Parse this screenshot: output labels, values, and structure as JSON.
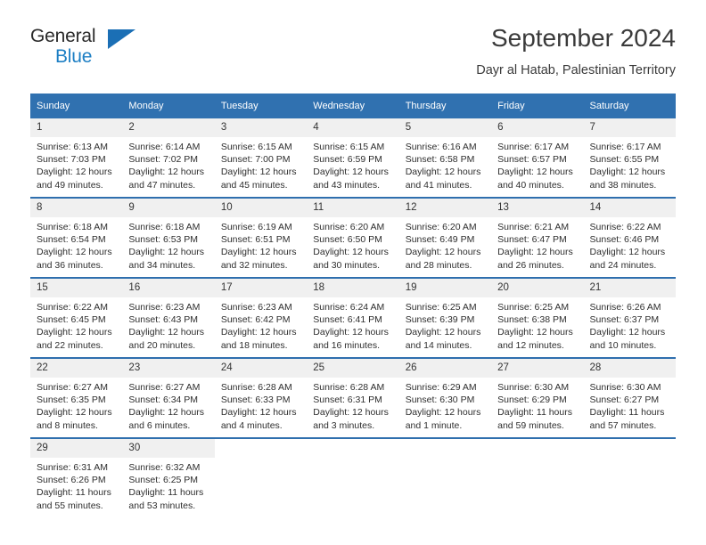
{
  "brand": {
    "name_part1": "General",
    "name_part2": "Blue"
  },
  "header": {
    "title": "September 2024",
    "subtitle": "Dayr al Hatab, Palestinian Territory"
  },
  "columns": [
    "Sunday",
    "Monday",
    "Tuesday",
    "Wednesday",
    "Thursday",
    "Friday",
    "Saturday"
  ],
  "colors": {
    "header_blue": "#3071b0",
    "row_divider_blue": "#2f6fae",
    "daynum_band": "#f0f0f0",
    "brand_blue": "#1d7fc4"
  },
  "weeks": [
    [
      {
        "day": "1",
        "sunrise": "Sunrise: 6:13 AM",
        "sunset": "Sunset: 7:03 PM",
        "daylight_line1": "Daylight: 12 hours",
        "daylight_line2": "and 49 minutes."
      },
      {
        "day": "2",
        "sunrise": "Sunrise: 6:14 AM",
        "sunset": "Sunset: 7:02 PM",
        "daylight_line1": "Daylight: 12 hours",
        "daylight_line2": "and 47 minutes."
      },
      {
        "day": "3",
        "sunrise": "Sunrise: 6:15 AM",
        "sunset": "Sunset: 7:00 PM",
        "daylight_line1": "Daylight: 12 hours",
        "daylight_line2": "and 45 minutes."
      },
      {
        "day": "4",
        "sunrise": "Sunrise: 6:15 AM",
        "sunset": "Sunset: 6:59 PM",
        "daylight_line1": "Daylight: 12 hours",
        "daylight_line2": "and 43 minutes."
      },
      {
        "day": "5",
        "sunrise": "Sunrise: 6:16 AM",
        "sunset": "Sunset: 6:58 PM",
        "daylight_line1": "Daylight: 12 hours",
        "daylight_line2": "and 41 minutes."
      },
      {
        "day": "6",
        "sunrise": "Sunrise: 6:17 AM",
        "sunset": "Sunset: 6:57 PM",
        "daylight_line1": "Daylight: 12 hours",
        "daylight_line2": "and 40 minutes."
      },
      {
        "day": "7",
        "sunrise": "Sunrise: 6:17 AM",
        "sunset": "Sunset: 6:55 PM",
        "daylight_line1": "Daylight: 12 hours",
        "daylight_line2": "and 38 minutes."
      }
    ],
    [
      {
        "day": "8",
        "sunrise": "Sunrise: 6:18 AM",
        "sunset": "Sunset: 6:54 PM",
        "daylight_line1": "Daylight: 12 hours",
        "daylight_line2": "and 36 minutes."
      },
      {
        "day": "9",
        "sunrise": "Sunrise: 6:18 AM",
        "sunset": "Sunset: 6:53 PM",
        "daylight_line1": "Daylight: 12 hours",
        "daylight_line2": "and 34 minutes."
      },
      {
        "day": "10",
        "sunrise": "Sunrise: 6:19 AM",
        "sunset": "Sunset: 6:51 PM",
        "daylight_line1": "Daylight: 12 hours",
        "daylight_line2": "and 32 minutes."
      },
      {
        "day": "11",
        "sunrise": "Sunrise: 6:20 AM",
        "sunset": "Sunset: 6:50 PM",
        "daylight_line1": "Daylight: 12 hours",
        "daylight_line2": "and 30 minutes."
      },
      {
        "day": "12",
        "sunrise": "Sunrise: 6:20 AM",
        "sunset": "Sunset: 6:49 PM",
        "daylight_line1": "Daylight: 12 hours",
        "daylight_line2": "and 28 minutes."
      },
      {
        "day": "13",
        "sunrise": "Sunrise: 6:21 AM",
        "sunset": "Sunset: 6:47 PM",
        "daylight_line1": "Daylight: 12 hours",
        "daylight_line2": "and 26 minutes."
      },
      {
        "day": "14",
        "sunrise": "Sunrise: 6:22 AM",
        "sunset": "Sunset: 6:46 PM",
        "daylight_line1": "Daylight: 12 hours",
        "daylight_line2": "and 24 minutes."
      }
    ],
    [
      {
        "day": "15",
        "sunrise": "Sunrise: 6:22 AM",
        "sunset": "Sunset: 6:45 PM",
        "daylight_line1": "Daylight: 12 hours",
        "daylight_line2": "and 22 minutes."
      },
      {
        "day": "16",
        "sunrise": "Sunrise: 6:23 AM",
        "sunset": "Sunset: 6:43 PM",
        "daylight_line1": "Daylight: 12 hours",
        "daylight_line2": "and 20 minutes."
      },
      {
        "day": "17",
        "sunrise": "Sunrise: 6:23 AM",
        "sunset": "Sunset: 6:42 PM",
        "daylight_line1": "Daylight: 12 hours",
        "daylight_line2": "and 18 minutes."
      },
      {
        "day": "18",
        "sunrise": "Sunrise: 6:24 AM",
        "sunset": "Sunset: 6:41 PM",
        "daylight_line1": "Daylight: 12 hours",
        "daylight_line2": "and 16 minutes."
      },
      {
        "day": "19",
        "sunrise": "Sunrise: 6:25 AM",
        "sunset": "Sunset: 6:39 PM",
        "daylight_line1": "Daylight: 12 hours",
        "daylight_line2": "and 14 minutes."
      },
      {
        "day": "20",
        "sunrise": "Sunrise: 6:25 AM",
        "sunset": "Sunset: 6:38 PM",
        "daylight_line1": "Daylight: 12 hours",
        "daylight_line2": "and 12 minutes."
      },
      {
        "day": "21",
        "sunrise": "Sunrise: 6:26 AM",
        "sunset": "Sunset: 6:37 PM",
        "daylight_line1": "Daylight: 12 hours",
        "daylight_line2": "and 10 minutes."
      }
    ],
    [
      {
        "day": "22",
        "sunrise": "Sunrise: 6:27 AM",
        "sunset": "Sunset: 6:35 PM",
        "daylight_line1": "Daylight: 12 hours",
        "daylight_line2": "and 8 minutes."
      },
      {
        "day": "23",
        "sunrise": "Sunrise: 6:27 AM",
        "sunset": "Sunset: 6:34 PM",
        "daylight_line1": "Daylight: 12 hours",
        "daylight_line2": "and 6 minutes."
      },
      {
        "day": "24",
        "sunrise": "Sunrise: 6:28 AM",
        "sunset": "Sunset: 6:33 PM",
        "daylight_line1": "Daylight: 12 hours",
        "daylight_line2": "and 4 minutes."
      },
      {
        "day": "25",
        "sunrise": "Sunrise: 6:28 AM",
        "sunset": "Sunset: 6:31 PM",
        "daylight_line1": "Daylight: 12 hours",
        "daylight_line2": "and 3 minutes."
      },
      {
        "day": "26",
        "sunrise": "Sunrise: 6:29 AM",
        "sunset": "Sunset: 6:30 PM",
        "daylight_line1": "Daylight: 12 hours",
        "daylight_line2": "and 1 minute."
      },
      {
        "day": "27",
        "sunrise": "Sunrise: 6:30 AM",
        "sunset": "Sunset: 6:29 PM",
        "daylight_line1": "Daylight: 11 hours",
        "daylight_line2": "and 59 minutes."
      },
      {
        "day": "28",
        "sunrise": "Sunrise: 6:30 AM",
        "sunset": "Sunset: 6:27 PM",
        "daylight_line1": "Daylight: 11 hours",
        "daylight_line2": "and 57 minutes."
      }
    ],
    [
      {
        "day": "29",
        "sunrise": "Sunrise: 6:31 AM",
        "sunset": "Sunset: 6:26 PM",
        "daylight_line1": "Daylight: 11 hours",
        "daylight_line2": "and 55 minutes."
      },
      {
        "day": "30",
        "sunrise": "Sunrise: 6:32 AM",
        "sunset": "Sunset: 6:25 PM",
        "daylight_line1": "Daylight: 11 hours",
        "daylight_line2": "and 53 minutes."
      },
      {
        "day": "",
        "sunrise": "",
        "sunset": "",
        "daylight_line1": "",
        "daylight_line2": ""
      },
      {
        "day": "",
        "sunrise": "",
        "sunset": "",
        "daylight_line1": "",
        "daylight_line2": ""
      },
      {
        "day": "",
        "sunrise": "",
        "sunset": "",
        "daylight_line1": "",
        "daylight_line2": ""
      },
      {
        "day": "",
        "sunrise": "",
        "sunset": "",
        "daylight_line1": "",
        "daylight_line2": ""
      },
      {
        "day": "",
        "sunrise": "",
        "sunset": "",
        "daylight_line1": "",
        "daylight_line2": ""
      }
    ]
  ]
}
